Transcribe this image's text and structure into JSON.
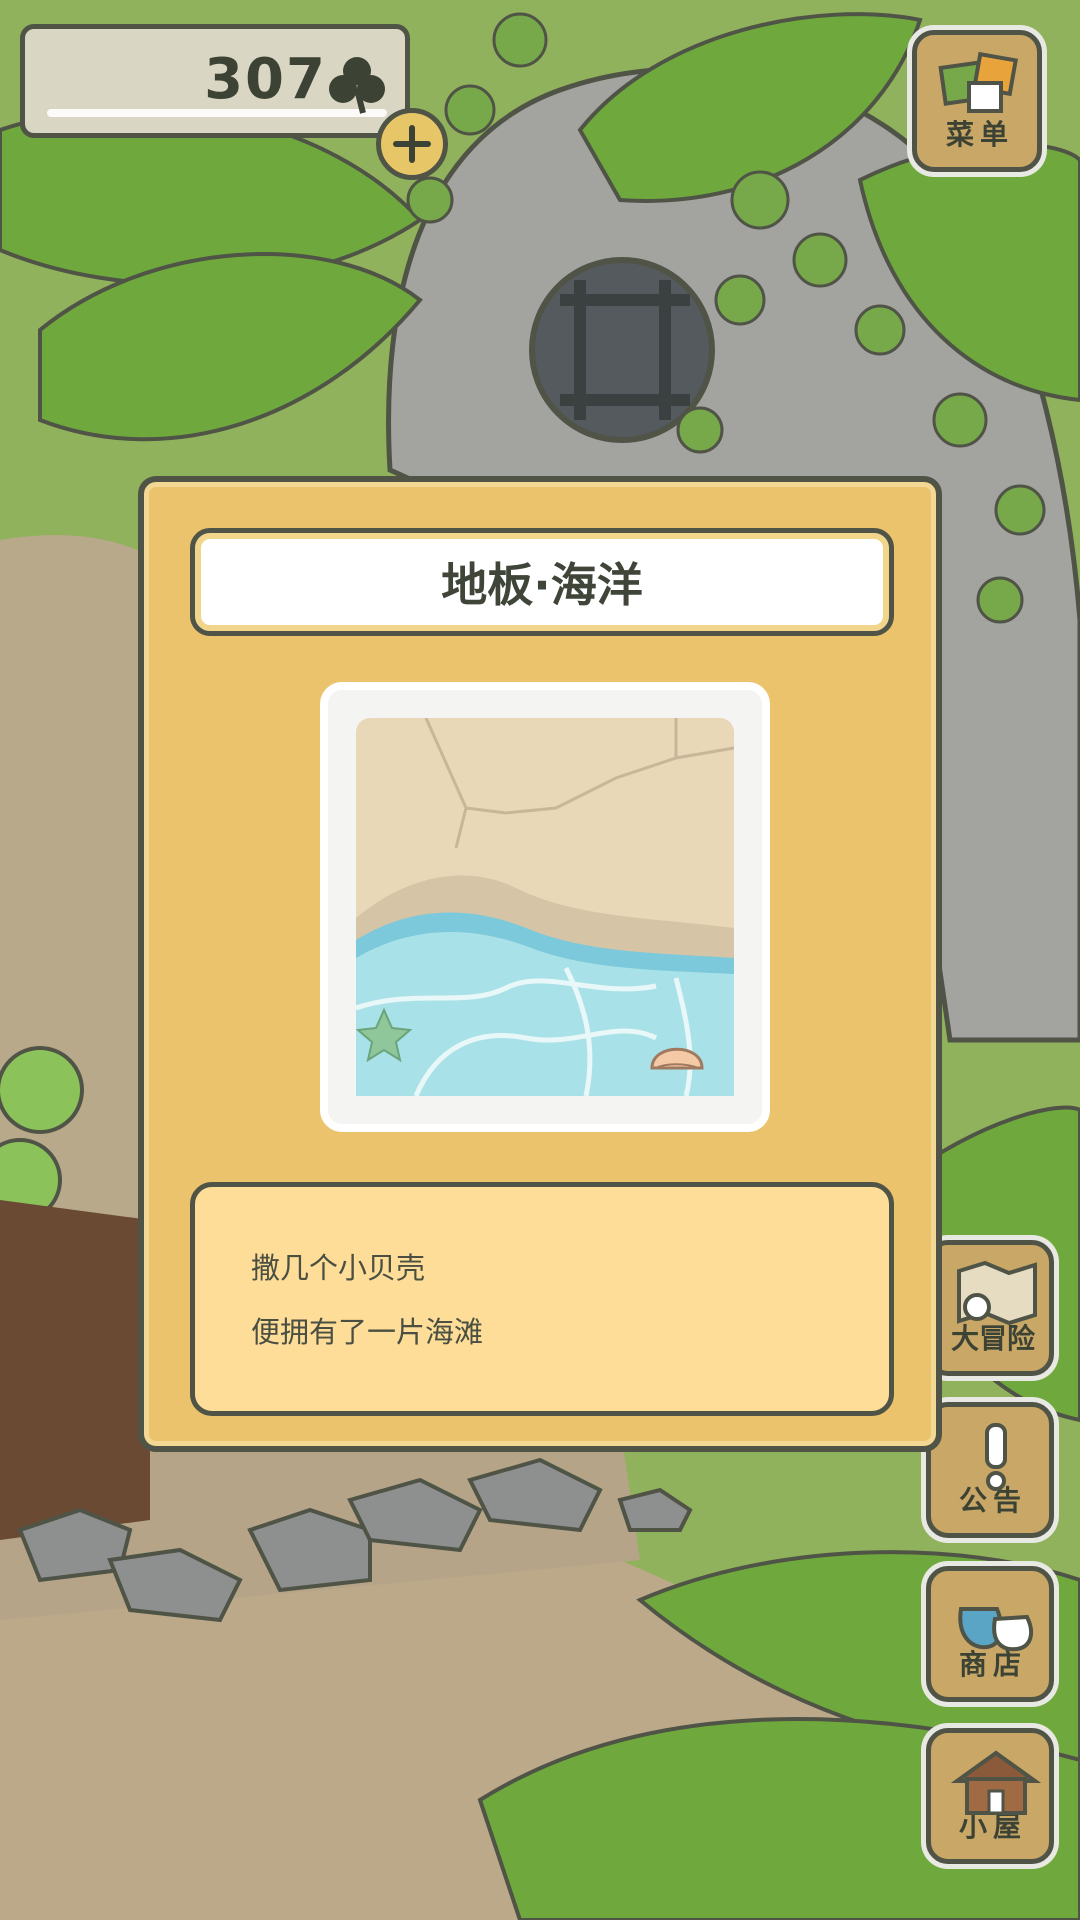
{
  "header": {
    "clover_count": "307",
    "clover_icon": "clover-icon",
    "add_icon": "plus-icon"
  },
  "side_menu": {
    "menu_label": "菜单",
    "adventure_label": "大冒险",
    "notice_label": "公告",
    "shop_label": "商店",
    "house_label": "小屋"
  },
  "item_dialog": {
    "title": "地板·海洋",
    "preview_icon": "ocean-floor-preview",
    "description": [
      "撒几个小贝壳",
      "便拥有了一片海滩"
    ]
  },
  "colors": {
    "dialog_bg": "#ecc36d",
    "desc_bg": "#fddd97",
    "outline": "#4f5446",
    "wood": "#c9a766"
  }
}
